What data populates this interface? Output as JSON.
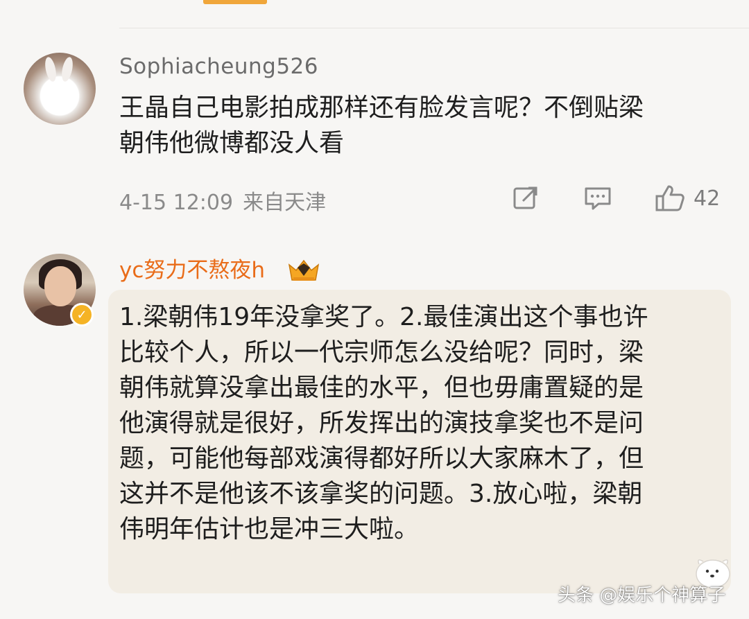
{
  "comments": [
    {
      "username": "Sophiacheung526",
      "text": "王晶自己电影拍成那样还有脸发言呢？不倒贴梁\n朝伟他微博都没人看",
      "time": "4-15 12:09",
      "location": "来自天津",
      "like_count": "42",
      "icons": [
        "share-icon",
        "reply-icon",
        "like-icon"
      ]
    },
    {
      "username": "yc努力不熬夜h",
      "badge": "crown-badge-icon",
      "verified": "verified-badge-icon",
      "text": "1.梁朝伟19年没拿奖了。2.最佳演出这个事也许\n比较个人，所以一代宗师怎么没给呢？同时，梁\n朝伟就算没拿出最佳的水平，但也毋庸置疑的是\n他演得就是很好，所发挥出的演技拿奖也不是问\n题，可能他每部戏演得都好所以大家麻木了，但\n这并不是他该不该拿奖的问题。3.放心啦，梁朝\n伟明年估计也是冲三大啦。"
    }
  ],
  "watermark": "头条 @娱乐个神算子",
  "colors": {
    "username_vip": "#e96c19",
    "top_accent": "#f0a63a",
    "verified": "#f5b325"
  }
}
